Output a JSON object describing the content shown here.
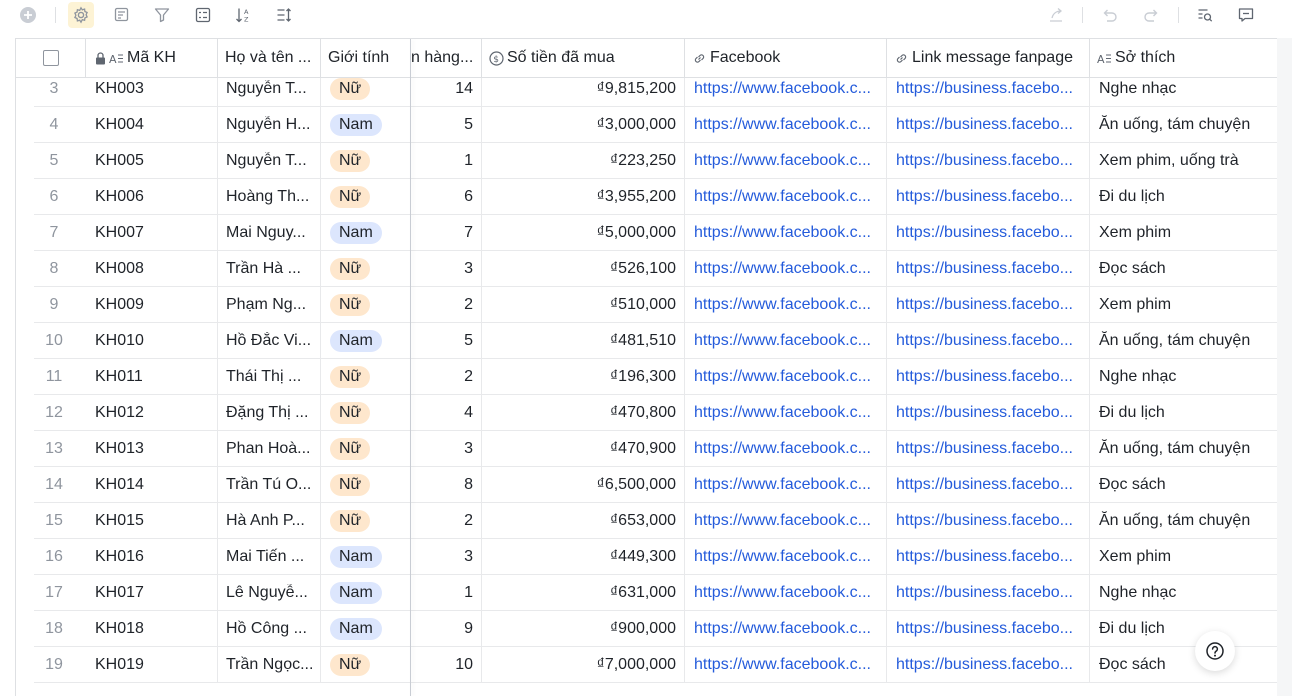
{
  "columns": {
    "id_label": "Mã KH",
    "name_label": "Họ và tên ...",
    "gender_label": "Giới tính",
    "orders_label": "n hàng...",
    "spent_label": "Số tiền đã mua",
    "facebook_label": "Facebook",
    "fanpage_label": "Link message fanpage",
    "hobby_label": "Sở thích"
  },
  "rows": [
    {
      "n": "3",
      "id": "KH003",
      "name": "Nguyễn T...",
      "gender": "Nữ",
      "orders": "14",
      "spent": "₫9,815,200",
      "fb": "https://www.facebook.c...",
      "fp": "https://business.facebo...",
      "hobby": "Nghe nhạc"
    },
    {
      "n": "4",
      "id": "KH004",
      "name": "Nguyễn H...",
      "gender": "Nam",
      "orders": "5",
      "spent": "₫3,000,000",
      "fb": "https://www.facebook.c...",
      "fp": "https://business.facebo...",
      "hobby": "Ăn uống, tám chuyện"
    },
    {
      "n": "5",
      "id": "KH005",
      "name": "Nguyễn T...",
      "gender": "Nữ",
      "orders": "1",
      "spent": "₫223,250",
      "fb": "https://www.facebook.c...",
      "fp": "https://business.facebo...",
      "hobby": "Xem phim, uống trà"
    },
    {
      "n": "6",
      "id": "KH006",
      "name": "Hoàng Th...",
      "gender": "Nữ",
      "orders": "6",
      "spent": "₫3,955,200",
      "fb": "https://www.facebook.c...",
      "fp": "https://business.facebo...",
      "hobby": "Đi du lịch"
    },
    {
      "n": "7",
      "id": "KH007",
      "name": "Mai Nguy...",
      "gender": "Nam",
      "orders": "7",
      "spent": "₫5,000,000",
      "fb": "https://www.facebook.c...",
      "fp": "https://business.facebo...",
      "hobby": "Xem phim"
    },
    {
      "n": "8",
      "id": "KH008",
      "name": "Trần Hà ...",
      "gender": "Nữ",
      "orders": "3",
      "spent": "₫526,100",
      "fb": "https://www.facebook.c...",
      "fp": "https://business.facebo...",
      "hobby": "Đọc sách"
    },
    {
      "n": "9",
      "id": "KH009",
      "name": "Phạm Ng...",
      "gender": "Nữ",
      "orders": "2",
      "spent": "₫510,000",
      "fb": "https://www.facebook.c...",
      "fp": "https://business.facebo...",
      "hobby": "Xem phim"
    },
    {
      "n": "10",
      "id": "KH010",
      "name": "Hồ Đắc Vi...",
      "gender": "Nam",
      "orders": "5",
      "spent": "₫481,510",
      "fb": "https://www.facebook.c...",
      "fp": "https://business.facebo...",
      "hobby": "Ăn uống, tám chuyện"
    },
    {
      "n": "11",
      "id": "KH011",
      "name": "Thái Thị ...",
      "gender": "Nữ",
      "orders": "2",
      "spent": "₫196,300",
      "fb": "https://www.facebook.c...",
      "fp": "https://business.facebo...",
      "hobby": "Nghe nhạc"
    },
    {
      "n": "12",
      "id": "KH012",
      "name": "Đặng Thị ...",
      "gender": "Nữ",
      "orders": "4",
      "spent": "₫470,800",
      "fb": "https://www.facebook.c...",
      "fp": "https://business.facebo...",
      "hobby": "Đi du lịch"
    },
    {
      "n": "13",
      "id": "KH013",
      "name": "Phan Hoà...",
      "gender": "Nữ",
      "orders": "3",
      "spent": "₫470,900",
      "fb": "https://www.facebook.c...",
      "fp": "https://business.facebo...",
      "hobby": "Ăn uống, tám chuyện"
    },
    {
      "n": "14",
      "id": "KH014",
      "name": "Trần Tú O...",
      "gender": "Nữ",
      "orders": "8",
      "spent": "₫6,500,000",
      "fb": "https://www.facebook.c...",
      "fp": "https://business.facebo...",
      "hobby": "Đọc sách"
    },
    {
      "n": "15",
      "id": "KH015",
      "name": "Hà Anh P...",
      "gender": "Nữ",
      "orders": "2",
      "spent": "₫653,000",
      "fb": "https://www.facebook.c...",
      "fp": "https://business.facebo...",
      "hobby": "Ăn uống, tám chuyện"
    },
    {
      "n": "16",
      "id": "KH016",
      "name": "Mai Tiến ...",
      "gender": "Nam",
      "orders": "3",
      "spent": "₫449,300",
      "fb": "https://www.facebook.c...",
      "fp": "https://business.facebo...",
      "hobby": "Xem phim"
    },
    {
      "n": "17",
      "id": "KH017",
      "name": "Lê Nguyễ...",
      "gender": "Nam",
      "orders": "1",
      "spent": "₫631,000",
      "fb": "https://www.facebook.c...",
      "fp": "https://business.facebo...",
      "hobby": "Nghe nhạc"
    },
    {
      "n": "18",
      "id": "KH018",
      "name": "Hồ Công ...",
      "gender": "Nam",
      "orders": "9",
      "spent": "₫900,000",
      "fb": "https://www.facebook.c...",
      "fp": "https://business.facebo...",
      "hobby": "Đi du lịch"
    },
    {
      "n": "19",
      "id": "KH019",
      "name": "Trần Ngọc...",
      "gender": "Nữ",
      "orders": "10",
      "spent": "₫7,000,000",
      "fb": "https://www.facebook.c...",
      "fp": "https://business.facebo...",
      "hobby": "Đọc sách"
    }
  ],
  "colors": {
    "female_tag": "#fee7cd",
    "male_tag": "#dce6fd",
    "link": "#245bdb",
    "active_tool": "#fdf3d5"
  },
  "icons": {
    "toolbar_left": [
      "add-circle-icon",
      "settings-icon",
      "field-list-icon",
      "filter-icon",
      "group-icon",
      "sort-icon",
      "row-height-icon"
    ],
    "toolbar_right": [
      "share-icon",
      "undo-icon",
      "redo-icon",
      "search-icon",
      "comment-icon"
    ],
    "floating": "help-icon"
  }
}
